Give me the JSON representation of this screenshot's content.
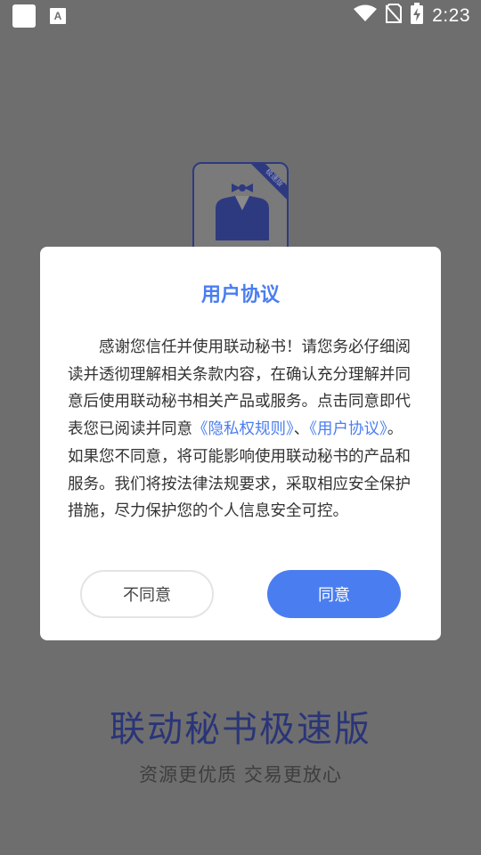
{
  "status_bar": {
    "time": "2:23",
    "left_icons": [
      "app-square-icon",
      "font-a-icon"
    ],
    "right_icons": [
      "wifi-icon",
      "no-sim-icon",
      "battery-charging-icon"
    ]
  },
  "background": {
    "logo_badge": "极速版",
    "app_name": "联动秘书极速版",
    "slogan": "资源更优质 交易更放心"
  },
  "dialog": {
    "title": "用户协议",
    "body_part1": "感谢您信任并使用联动秘书！请您务必仔细阅读并透彻理解相关条款内容，在确认充分理解并同意后使用联动秘书相关产品或服务。点击同意即代表您已阅读并同意",
    "privacy_link": "《隐私权规则》",
    "separator": "、",
    "user_agreement_link": "《用户协议》",
    "body_part2": "。如果您不同意，将可能影响使用联动秘书的产品和服务。我们将按法律法规要求，采取相应安全保护措施，尽力保护您的个人信息安全可控。",
    "disagree_label": "不同意",
    "agree_label": "同意"
  },
  "colors": {
    "accent": "#4a7ef0",
    "overlay": "#6e6e6e",
    "brand_dark": "#2a3578"
  }
}
